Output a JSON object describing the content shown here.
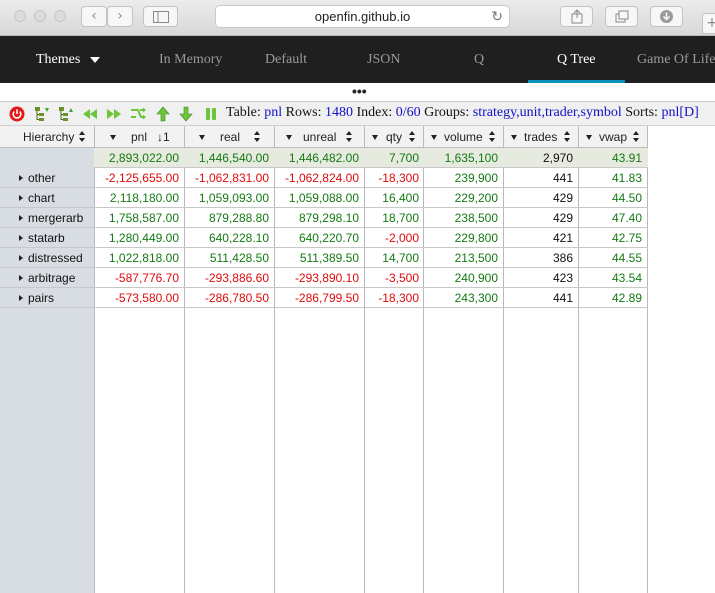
{
  "browser": {
    "address": "openfin.github.io"
  },
  "nav": {
    "themes_label": "Themes",
    "tabs": [
      {
        "label": "In Memory"
      },
      {
        "label": "Default"
      },
      {
        "label": "JSON"
      },
      {
        "label": "Q"
      },
      {
        "label": "Q Tree",
        "active": true
      },
      {
        "label": "Game Of Life"
      }
    ]
  },
  "toolbar": {
    "icons": [
      "power-icon",
      "expand-all-icon",
      "collapse-all-icon",
      "rewind-icon",
      "fast-forward-icon",
      "shuffle-icon",
      "arrow-up-icon",
      "arrow-down-icon",
      "pause-icon"
    ],
    "table_label": "Table:",
    "table_value": "pnl",
    "rows_label": "Rows:",
    "rows_value": "1480",
    "index_label": "Index:",
    "index_value": "0/60",
    "groups_label": "Groups:",
    "groups_value": "strategy,unit,trader,symbol",
    "sorts_label": "Sorts:",
    "sorts_value": "pnl[D]"
  },
  "grid": {
    "hierarchy_header": "Hierarchy",
    "columns": [
      {
        "label": "pnl",
        "sort_indicator": "↓1"
      },
      {
        "label": "real"
      },
      {
        "label": "unreal"
      },
      {
        "label": "qty"
      },
      {
        "label": "volume"
      },
      {
        "label": "trades"
      },
      {
        "label": "vwap"
      }
    ],
    "totals": [
      "2,893,022.00",
      "1,446,540.00",
      "1,446,482.00",
      "7,700",
      "1,635,100",
      "2,970",
      "43.91"
    ],
    "rows": [
      {
        "label": "other",
        "values": [
          "-2,125,655.00",
          "-1,062,831.00",
          "-1,062,824.00",
          "-18,300",
          "239,900",
          "441",
          "41.83"
        ]
      },
      {
        "label": "chart",
        "values": [
          "2,118,180.00",
          "1,059,093.00",
          "1,059,088.00",
          "16,400",
          "229,200",
          "429",
          "44.50"
        ]
      },
      {
        "label": "mergerarb",
        "values": [
          "1,758,587.00",
          "879,288.80",
          "879,298.10",
          "18,700",
          "238,500",
          "429",
          "47.40"
        ]
      },
      {
        "label": "statarb",
        "values": [
          "1,280,449.00",
          "640,228.10",
          "640,220.70",
          "-2,000",
          "229,800",
          "421",
          "42.75"
        ]
      },
      {
        "label": "distressed",
        "values": [
          "1,022,818.00",
          "511,428.50",
          "511,389.50",
          "14,700",
          "213,500",
          "386",
          "44.55"
        ]
      },
      {
        "label": "arbitrage",
        "values": [
          "-587,776.70",
          "-293,886.60",
          "-293,890.10",
          "-3,500",
          "240,900",
          "423",
          "43.54"
        ]
      },
      {
        "label": "pairs",
        "values": [
          "-573,580.00",
          "-286,780.50",
          "-286,799.50",
          "-18,300",
          "243,300",
          "441",
          "42.89"
        ]
      }
    ]
  },
  "colors": {
    "positive": "#137a13",
    "negative": "#e00a0a",
    "link": "#1010c8",
    "nav_bg": "#1f1f1f",
    "active_tab_underline": "#0b8fbd"
  }
}
